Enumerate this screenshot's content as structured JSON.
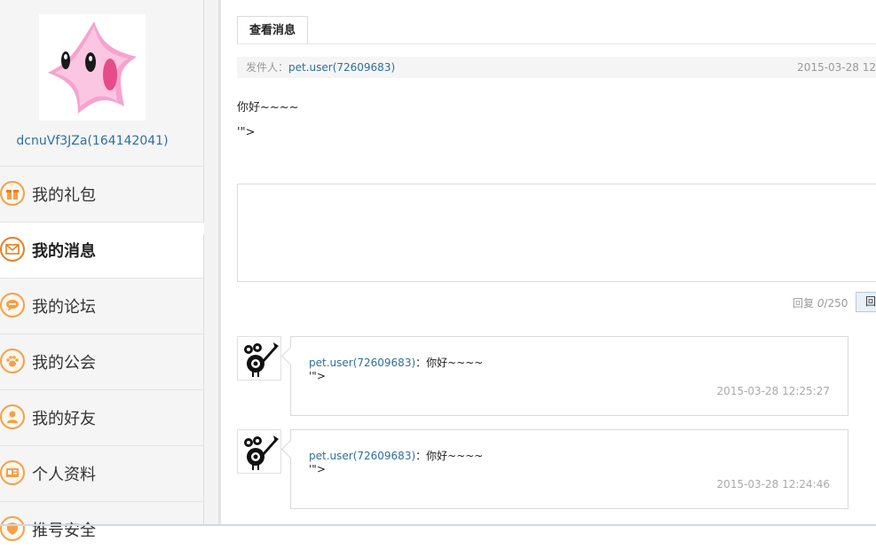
{
  "sidebar": {
    "username": "dcnuVf3JZa(164142041)",
    "items": [
      {
        "label": "我的礼包",
        "icon": "gift-icon",
        "active": false
      },
      {
        "label": "我的消息",
        "icon": "mail-icon",
        "active": true
      },
      {
        "label": "我的论坛",
        "icon": "chat-bubble-icon",
        "active": false
      },
      {
        "label": "我的公会",
        "icon": "paw-icon",
        "active": false
      },
      {
        "label": "我的好友",
        "icon": "person-icon",
        "active": false
      },
      {
        "label": "个人资料",
        "icon": "id-card-icon",
        "active": false
      },
      {
        "label": "推号安全",
        "icon": "shield-icon",
        "active": false
      }
    ]
  },
  "main": {
    "tab_label": "查看消息",
    "sender_label": "发件人：",
    "sender_name": "pet.user(72609683)",
    "message_date": "2015-03-28 12",
    "message_lines": [
      "你好~~~~",
      "'\">"
    ],
    "reply": {
      "counter_label": "回复",
      "count": "0",
      "max": "/250",
      "button_label": "回"
    },
    "thread": [
      {
        "name": "pet.user(72609683)",
        "text": "：你好~~~~",
        "line2": "'\">",
        "date": "2015-03-28 12:25:27"
      },
      {
        "name": "pet.user(72609683)",
        "text": "：你好~~~~",
        "line2": "'\">",
        "date": "2015-03-28 12:24:46"
      }
    ]
  },
  "colors": {
    "link": "#2e6f9e",
    "accent_orange": "#f2a04b",
    "sidebar_bg": "#f5f5f5"
  }
}
